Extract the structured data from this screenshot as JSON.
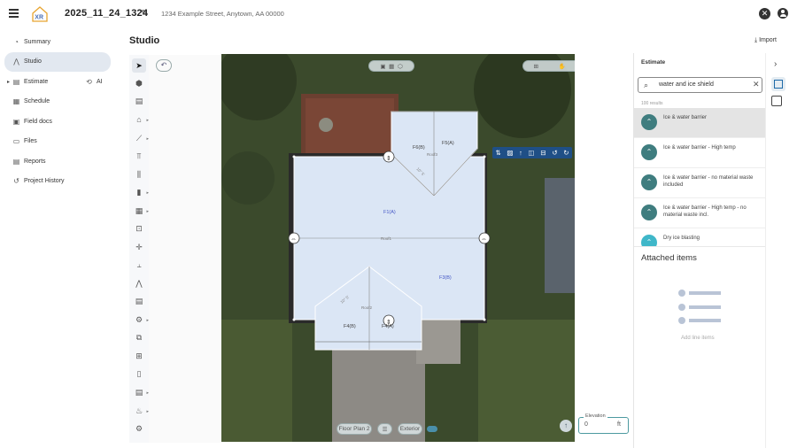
{
  "header": {
    "logo_text": "XR",
    "project_title": "2025_11_24_1324",
    "address": "1234 Example Street, Anytown, AA 00000"
  },
  "sidebar": {
    "items": [
      {
        "label": "Summary",
        "icon": "summary-icon"
      },
      {
        "label": "Studio",
        "icon": "studio-icon",
        "active": true
      },
      {
        "label": "Estimate",
        "icon": "estimate-icon"
      },
      {
        "label": "Schedule",
        "icon": "schedule-icon"
      },
      {
        "label": "Field docs",
        "icon": "field-docs-icon"
      },
      {
        "label": "Files",
        "icon": "files-icon"
      },
      {
        "label": "Reports",
        "icon": "reports-icon"
      },
      {
        "label": "Project History",
        "icon": "history-icon"
      }
    ],
    "ai_label": "AI"
  },
  "main": {
    "title": "Studio",
    "import_label": "Import"
  },
  "canvas": {
    "roof_labels": {
      "f1": "F1(A)",
      "f3": "F3(B)",
      "f4": "F4(B)",
      "f5": "F5(A)",
      "f6": "F6(B)",
      "roof1": "Roof1",
      "roof2": "Roof2",
      "roof3": "Roof3",
      "pitch1": "10\" 5'",
      "pitch2": "10\" 5'",
      "f4b": "F4(A)"
    },
    "bottom_controls": {
      "floor_plan": "Floor Plan 2",
      "exterior": "Exterior"
    },
    "elevation": {
      "label": "Elevation",
      "value": "0",
      "unit": "ft"
    }
  },
  "estimate_panel": {
    "title": "Estimate",
    "search_value": "water and ice shield",
    "results_count": "100 results",
    "results": [
      {
        "text": "Ice & water barrier",
        "selected": true
      },
      {
        "text": "Ice & water barrier - High temp"
      },
      {
        "text": "Ice & water barrier - no material waste included"
      },
      {
        "text": "Ice & water barrier - High temp - no material waste incl."
      },
      {
        "text": "Dry ice blasting"
      }
    ],
    "attached_title": "Attached items",
    "add_line_items": "Add line items"
  },
  "colors": {
    "accent": "#3f7d7f",
    "roof_fill": "#dbe6f5",
    "active_nav": "#e2e8f0",
    "map_grass": "#3d4a2e"
  }
}
